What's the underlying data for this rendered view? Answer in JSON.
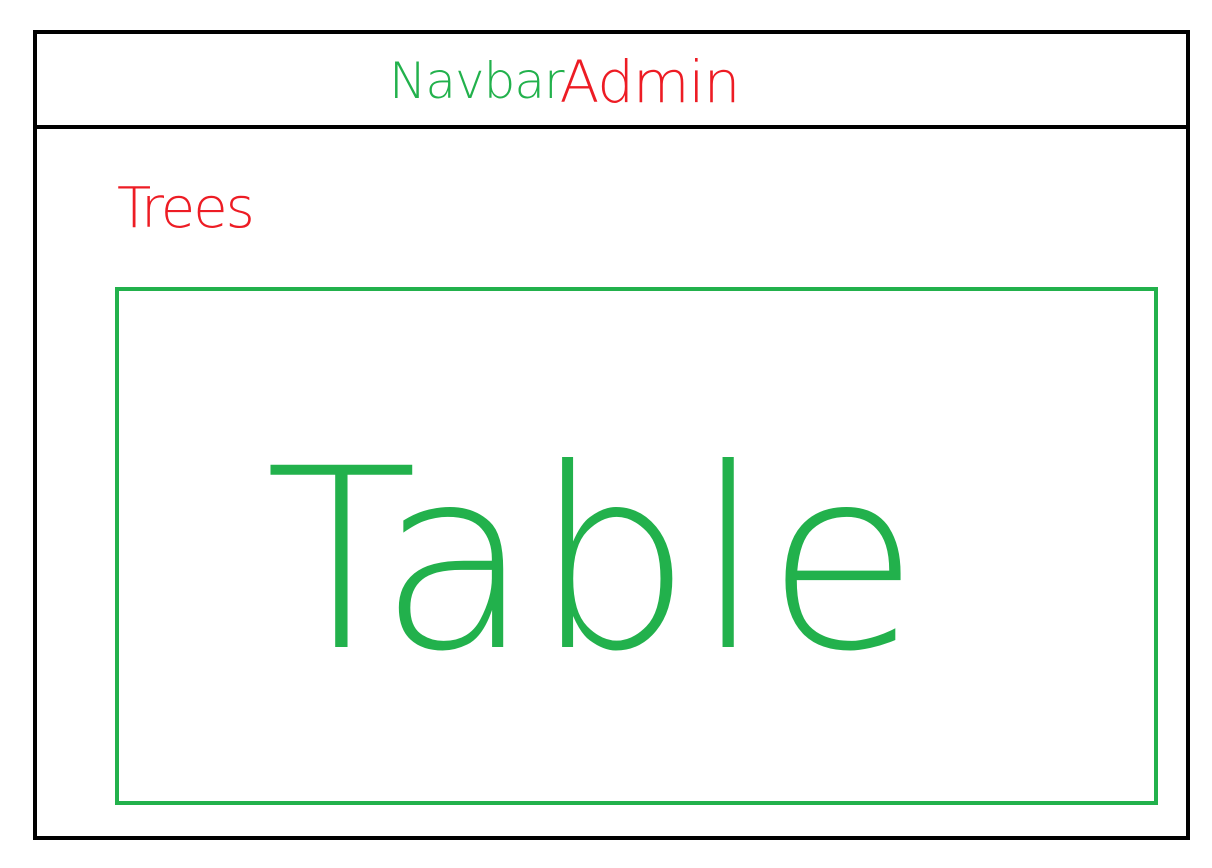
{
  "navbar": {
    "title_part1": "Navbar",
    "title_part2": "Admin"
  },
  "page": {
    "heading": "Trees"
  },
  "table": {
    "label": "Table"
  },
  "colors": {
    "frame": "#000000",
    "green": "#22b14c",
    "red": "#ed1c24"
  }
}
